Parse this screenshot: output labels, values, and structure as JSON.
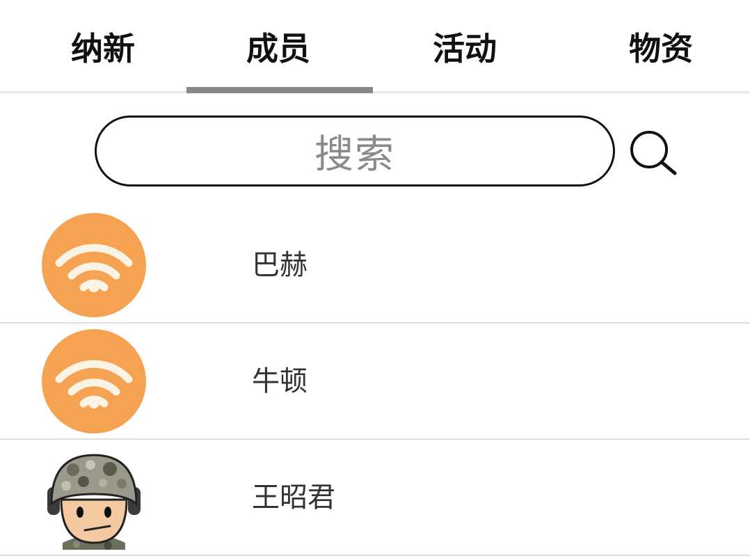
{
  "tabs": [
    {
      "label": "纳新",
      "active": false
    },
    {
      "label": "成员",
      "active": true
    },
    {
      "label": "活动",
      "active": false
    },
    {
      "label": "物资",
      "active": false
    }
  ],
  "search": {
    "placeholder": "搜索",
    "icon": "search-icon"
  },
  "members": [
    {
      "name": "巴赫",
      "avatar": "wifi-icon"
    },
    {
      "name": "牛顿",
      "avatar": "wifi-icon"
    },
    {
      "name": "王昭君",
      "avatar": "soldier-avatar"
    }
  ],
  "colors": {
    "avatar_bg": "#f5a352",
    "indicator": "#888888",
    "placeholder": "#8a8a8a"
  }
}
